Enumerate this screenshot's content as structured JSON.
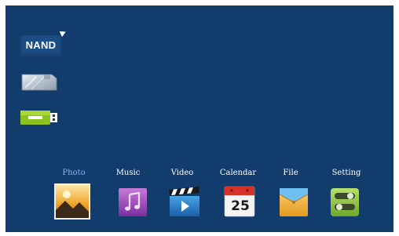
{
  "sources": [
    {
      "id": "nand",
      "label": "NAND",
      "icon": "nand-storage-icon",
      "selected": true
    },
    {
      "id": "sd",
      "label": "",
      "icon": "sd-card-icon"
    },
    {
      "id": "usb",
      "label": "",
      "icon": "usb-drive-icon"
    }
  ],
  "menu": {
    "active": "Photo",
    "items": [
      {
        "label": "Photo",
        "icon": "photo-icon"
      },
      {
        "label": "Music",
        "icon": "music-icon"
      },
      {
        "label": "Video",
        "icon": "video-icon"
      },
      {
        "label": "Calendar",
        "icon": "calendar-icon"
      },
      {
        "label": "File",
        "icon": "file-icon"
      },
      {
        "label": "Setting",
        "icon": "setting-icon"
      }
    ]
  },
  "calendar_day": "25",
  "colors": {
    "background": "#113c6c",
    "active_label": "#7fb8f0",
    "label": "#ffffff"
  }
}
